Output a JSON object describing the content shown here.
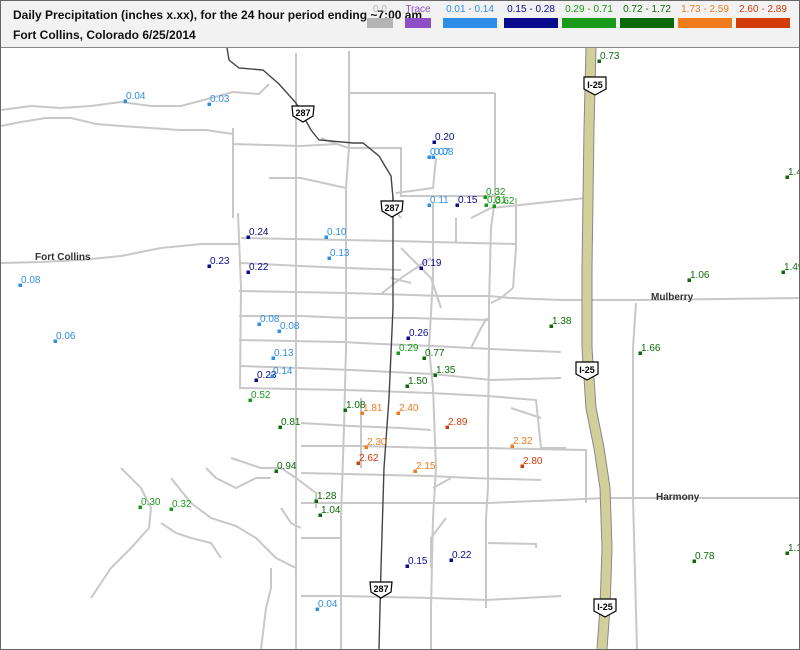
{
  "header": {
    "title": "Daily Precipitation (inches  x.xx),  for the 24 hour period ending ~7:00 am",
    "subtitle": "Fort Collins, Colorado  6/25/2014"
  },
  "legend": [
    {
      "label": "0.0",
      "color": "#b4b4b4"
    },
    {
      "label": "Trace",
      "color": "#8c4fc4"
    },
    {
      "label": "0.01 - 0.14",
      "color": "#2e8de6"
    },
    {
      "label": "0.15 - 0.28",
      "color": "#0a0a8c"
    },
    {
      "label": "0.29 - 0.71",
      "color": "#1a9a1a"
    },
    {
      "label": "0.72 - 1.72",
      "color": "#0a6a0a"
    },
    {
      "label": "1.73 - 2.59",
      "color": "#f07a1e"
    },
    {
      "label": "2.60 - 2.89",
      "color": "#d23c0a"
    }
  ],
  "places": {
    "city": "Fort Collins",
    "mulberry": "Mulberry",
    "harmony": "Harmony"
  },
  "shields": {
    "us287_a": "287",
    "us287_b": "287",
    "us287_c": "287",
    "i25_a": "I-25",
    "i25_b": "I-25",
    "i25_c": "I-25"
  },
  "observations": [
    {
      "value": "0.04",
      "color": "#2e8de6"
    },
    {
      "value": "0.03",
      "color": "#2e8de6"
    },
    {
      "value": "0.73",
      "color": "#0a6a0a"
    },
    {
      "value": "0.20",
      "color": "#0a0a8c"
    },
    {
      "value": "0.07",
      "color": "#2e8de6"
    },
    {
      "value": "0.08",
      "color": "#2e8de6"
    },
    {
      "value": "0.32",
      "color": "#1a9a1a"
    },
    {
      "value": "0.11",
      "color": "#2e8de6"
    },
    {
      "value": "0.15",
      "color": "#0a0a8c"
    },
    {
      "value": "0.31",
      "color": "#1a9a1a"
    },
    {
      "value": "0.62",
      "color": "#1a9a1a"
    },
    {
      "value": "1.4",
      "color": "#0a6a0a"
    },
    {
      "value": "0.24",
      "color": "#0a0a8c"
    },
    {
      "value": "0.10",
      "color": "#2e8de6"
    },
    {
      "value": "0.13",
      "color": "#2e8de6"
    },
    {
      "value": "0.23",
      "color": "#0a0a8c"
    },
    {
      "value": "0.22",
      "color": "#0a0a8c"
    },
    {
      "value": "0.19",
      "color": "#0a0a8c"
    },
    {
      "value": "0.08",
      "color": "#2e8de6"
    },
    {
      "value": "1.06",
      "color": "#0a6a0a"
    },
    {
      "value": "1.49",
      "color": "#0a6a0a"
    },
    {
      "value": "0.08",
      "color": "#2e8de6"
    },
    {
      "value": "0.08",
      "color": "#2e8de6"
    },
    {
      "value": "1.38",
      "color": "#0a6a0a"
    },
    {
      "value": "0.06",
      "color": "#2e8de6"
    },
    {
      "value": "0.26",
      "color": "#0a0a8c"
    },
    {
      "value": "0.13",
      "color": "#2e8de6"
    },
    {
      "value": "0.29",
      "color": "#1a9a1a"
    },
    {
      "value": "0.77",
      "color": "#0a6a0a"
    },
    {
      "value": "1.66",
      "color": "#0a6a0a"
    },
    {
      "value": "0.23",
      "color": "#0a0a8c"
    },
    {
      "value": "0.14",
      "color": "#2e8de6"
    },
    {
      "value": "1.35",
      "color": "#0a6a0a"
    },
    {
      "value": "1.50",
      "color": "#0a6a0a"
    },
    {
      "value": "0.52",
      "color": "#1a9a1a"
    },
    {
      "value": "1.08",
      "color": "#0a6a0a"
    },
    {
      "value": "1.81",
      "color": "#f07a1e"
    },
    {
      "value": "2.40",
      "color": "#f07a1e"
    },
    {
      "value": "0.81",
      "color": "#0a6a0a"
    },
    {
      "value": "2.89",
      "color": "#d23c0a"
    },
    {
      "value": "2.30",
      "color": "#f07a1e"
    },
    {
      "value": "2.32",
      "color": "#f07a1e"
    },
    {
      "value": "2.62",
      "color": "#d23c0a"
    },
    {
      "value": "2.80",
      "color": "#d23c0a"
    },
    {
      "value": "0.94",
      "color": "#0a6a0a"
    },
    {
      "value": "2.15",
      "color": "#f07a1e"
    },
    {
      "value": "1.28",
      "color": "#0a6a0a"
    },
    {
      "value": "0.30",
      "color": "#1a9a1a"
    },
    {
      "value": "0.32",
      "color": "#1a9a1a"
    },
    {
      "value": "1.04",
      "color": "#0a6a0a"
    },
    {
      "value": "0.15",
      "color": "#0a0a8c"
    },
    {
      "value": "0.22",
      "color": "#0a0a8c"
    },
    {
      "value": "0.78",
      "color": "#0a6a0a"
    },
    {
      "value": "1.1",
      "color": "#0a6a0a"
    },
    {
      "value": "0.04",
      "color": "#2e8de6"
    }
  ]
}
